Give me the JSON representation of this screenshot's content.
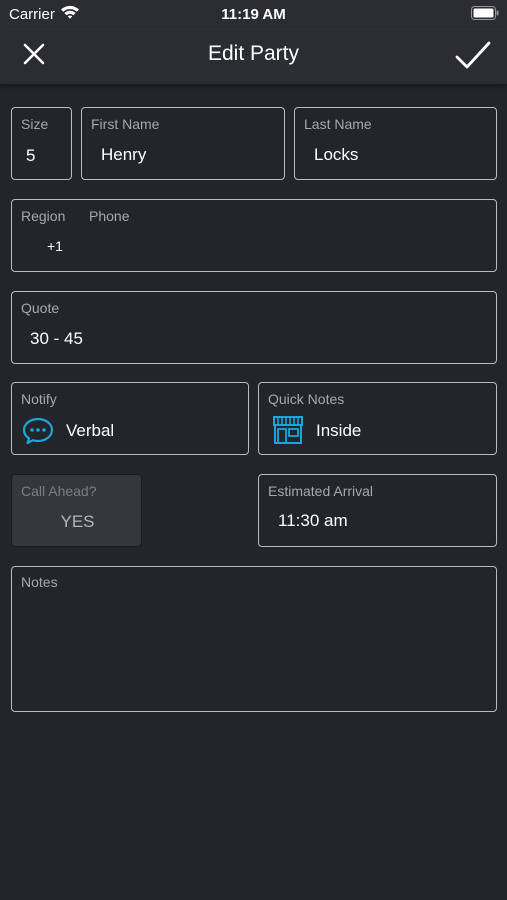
{
  "status_bar": {
    "carrier": "Carrier",
    "time": "11:19 AM"
  },
  "nav": {
    "title": "Edit Party",
    "close_icon": "close-icon",
    "done_icon": "checkmark-icon"
  },
  "form": {
    "size": {
      "label": "Size",
      "value": "5"
    },
    "first_name": {
      "label": "First Name",
      "value": "Henry"
    },
    "last_name": {
      "label": "Last Name",
      "value": "Locks"
    },
    "region": {
      "label": "Region",
      "value": "+1"
    },
    "phone": {
      "label": "Phone",
      "value": ""
    },
    "quote": {
      "label": "Quote",
      "value": "30 - 45"
    },
    "notify": {
      "label": "Notify",
      "value": "Verbal",
      "icon": "chat-bubble-icon"
    },
    "quick_notes": {
      "label": "Quick Notes",
      "value": "Inside",
      "icon": "storefront-icon"
    },
    "call_ahead": {
      "label": "Call Ahead?",
      "value": "YES"
    },
    "estimated_arrival": {
      "label": "Estimated Arrival",
      "value": "11:30 am"
    },
    "notes": {
      "label": "Notes",
      "value": ""
    }
  },
  "colors": {
    "background": "#23252b",
    "bar": "#2b2d33",
    "accent": "#1aa6d9",
    "border": "#b9bbc0"
  }
}
